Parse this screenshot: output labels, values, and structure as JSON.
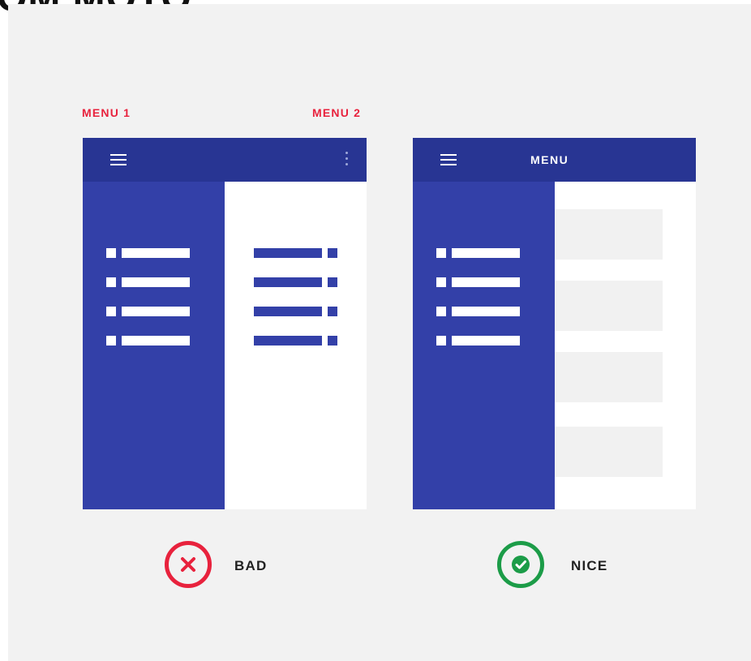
{
  "header": {
    "partial_title": "OM MOTO."
  },
  "labels": {
    "menu1": "MENU 1",
    "menu2": "MENU 2"
  },
  "bad_mockup": {
    "left_list_rows": 4,
    "right_list_rows": 4,
    "verdict": "BAD",
    "verdict_icon": "close-icon",
    "verdict_color": "#e8223d"
  },
  "nice_mockup": {
    "appbar_title": "MENU",
    "list_rows": 4,
    "cards": 4,
    "verdict": "NICE",
    "verdict_icon": "check-icon",
    "verdict_color": "#1c9c48"
  },
  "colors": {
    "appbar": "#283593",
    "drawer": "#3340a8",
    "background": "#f2f2f2",
    "label_red": "#e8223d"
  }
}
